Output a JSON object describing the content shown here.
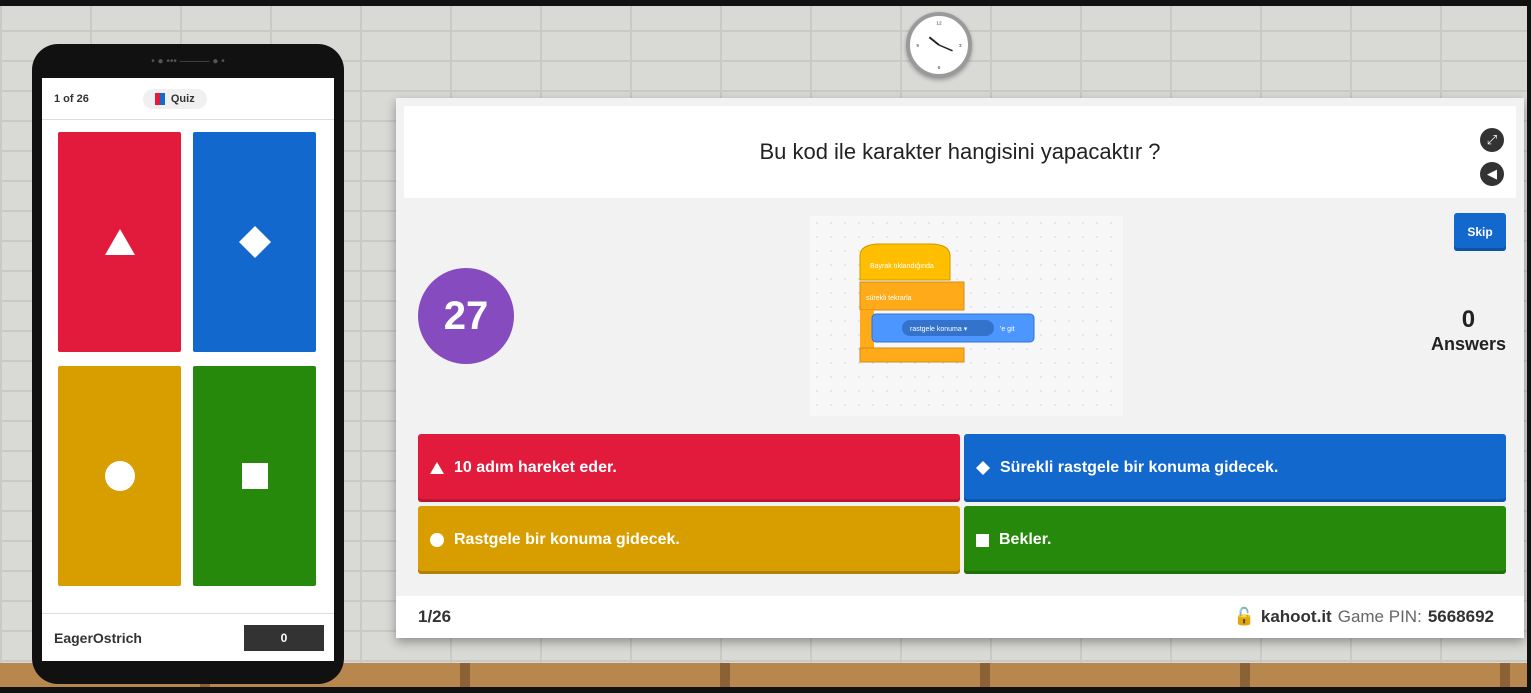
{
  "phone": {
    "progress": "1 of 26",
    "mode_label": "Quiz",
    "player_name": "EagerOstrich",
    "score": "0",
    "tiles": [
      {
        "shape": "triangle-icon",
        "color": "#e21b3c"
      },
      {
        "shape": "diamond-icon",
        "color": "#1368ce"
      },
      {
        "shape": "circle-icon",
        "color": "#d89e00"
      },
      {
        "shape": "square-icon",
        "color": "#26890c"
      }
    ]
  },
  "question": {
    "text": "Bu kod ile karakter hangisini yapacaktır ?",
    "timer": "27",
    "answers_count": "0",
    "answers_label": "Answers",
    "skip_label": "Skip"
  },
  "code_blocks": {
    "hat": "Bayrak tıklandığında",
    "loop": "sürekli tekrarla",
    "motion_dropdown": "rastgele konuma ▾",
    "motion_suffix": "'e git"
  },
  "options": [
    {
      "icon": "triangle-icon",
      "text": "10 adım hareket eder.",
      "color": "#e21b3c"
    },
    {
      "icon": "diamond-icon",
      "text": "Sürekli rastgele bir konuma gidecek.",
      "color": "#1368ce"
    },
    {
      "icon": "circle-icon",
      "text": "Rastgele bir konuma gidecek.",
      "color": "#d89e00"
    },
    {
      "icon": "square-icon",
      "text": "Bekler.",
      "color": "#26890c"
    }
  ],
  "footer": {
    "progress": "1/26",
    "site": "kahoot.it",
    "pin_label": "Game PIN:",
    "pin": "5668692"
  }
}
